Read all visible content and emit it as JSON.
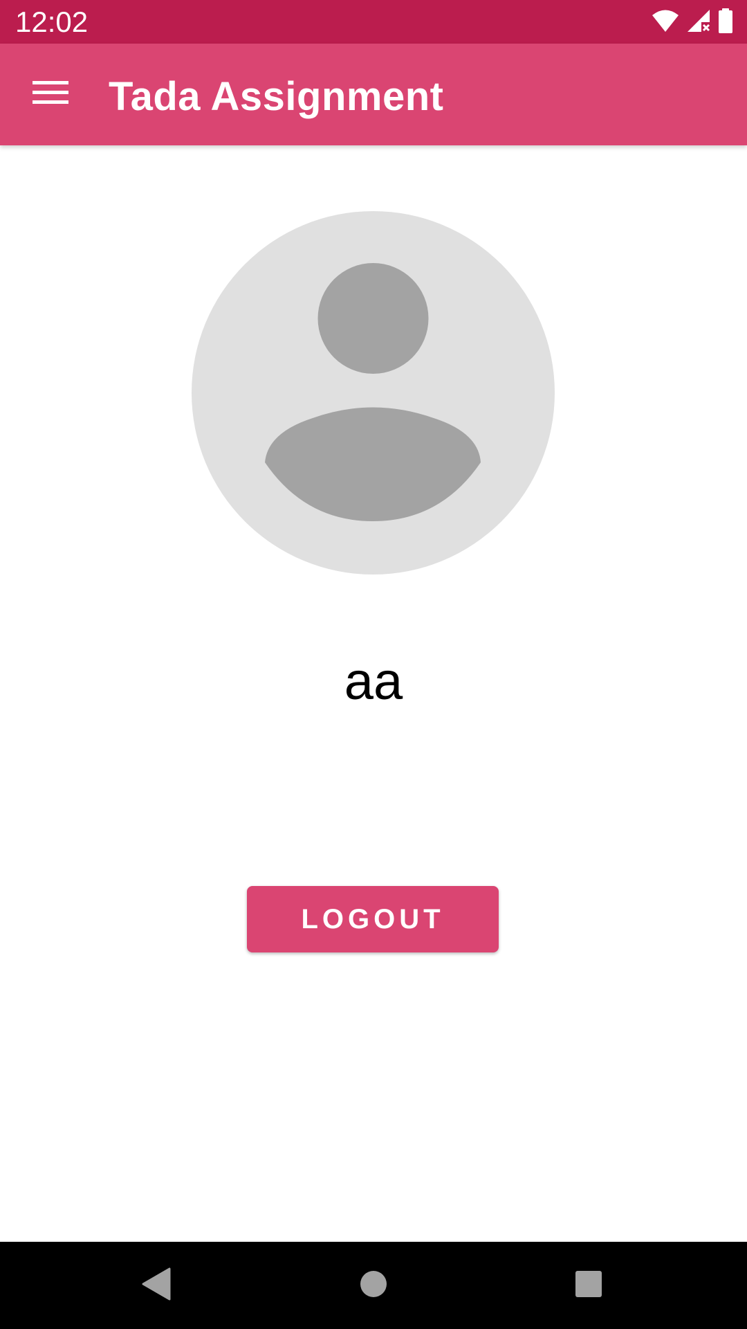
{
  "status_bar": {
    "time": "12:02",
    "icons": [
      "wifi-icon",
      "signal-icon",
      "battery-icon"
    ],
    "color": "#bb1d4e"
  },
  "app_bar": {
    "title": "Tada Assignment",
    "menu_icon": "menu-icon",
    "color": "#da4572"
  },
  "profile": {
    "avatar_icon": "default-avatar-icon",
    "name": "aa"
  },
  "actions": {
    "logout_label": "LOGOUT",
    "logout_color": "#da4572"
  },
  "nav_bar": {
    "buttons": [
      "back-icon",
      "home-icon",
      "recents-icon"
    ]
  }
}
